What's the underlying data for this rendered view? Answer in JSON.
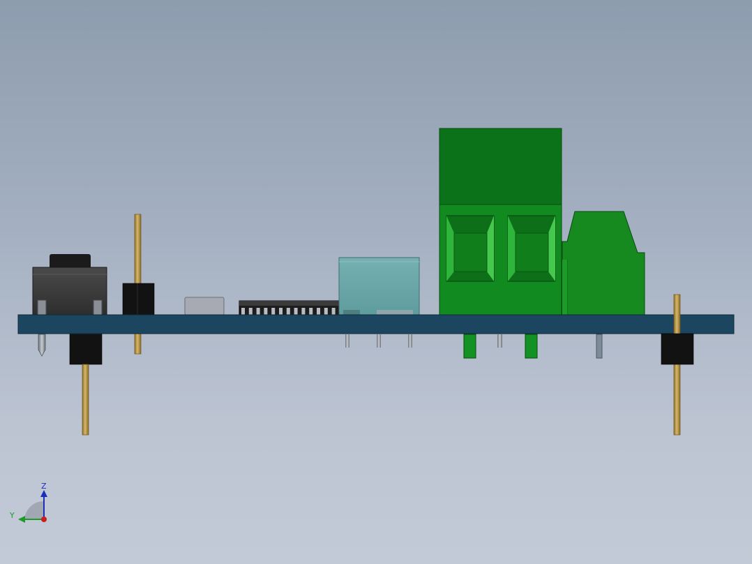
{
  "window": {
    "description_free": true
  },
  "triad": {
    "z_label": "Z",
    "y_label": "Y",
    "colors": {
      "z_axis": "#1a2fb8",
      "y_axis": "#1f9a2a",
      "x_axis": "#c81e1e"
    }
  },
  "colors": {
    "background_top": "#8d9cae",
    "background_bottom": "#c3cad7",
    "pcb": "#1c4660",
    "terminal_green": "#0c7a1c",
    "terminal_green_light": "#1d8f28",
    "header_pin_gold": "#b9984a",
    "plastic_black": "#121212",
    "usb_metal": "#6ea9aa"
  }
}
